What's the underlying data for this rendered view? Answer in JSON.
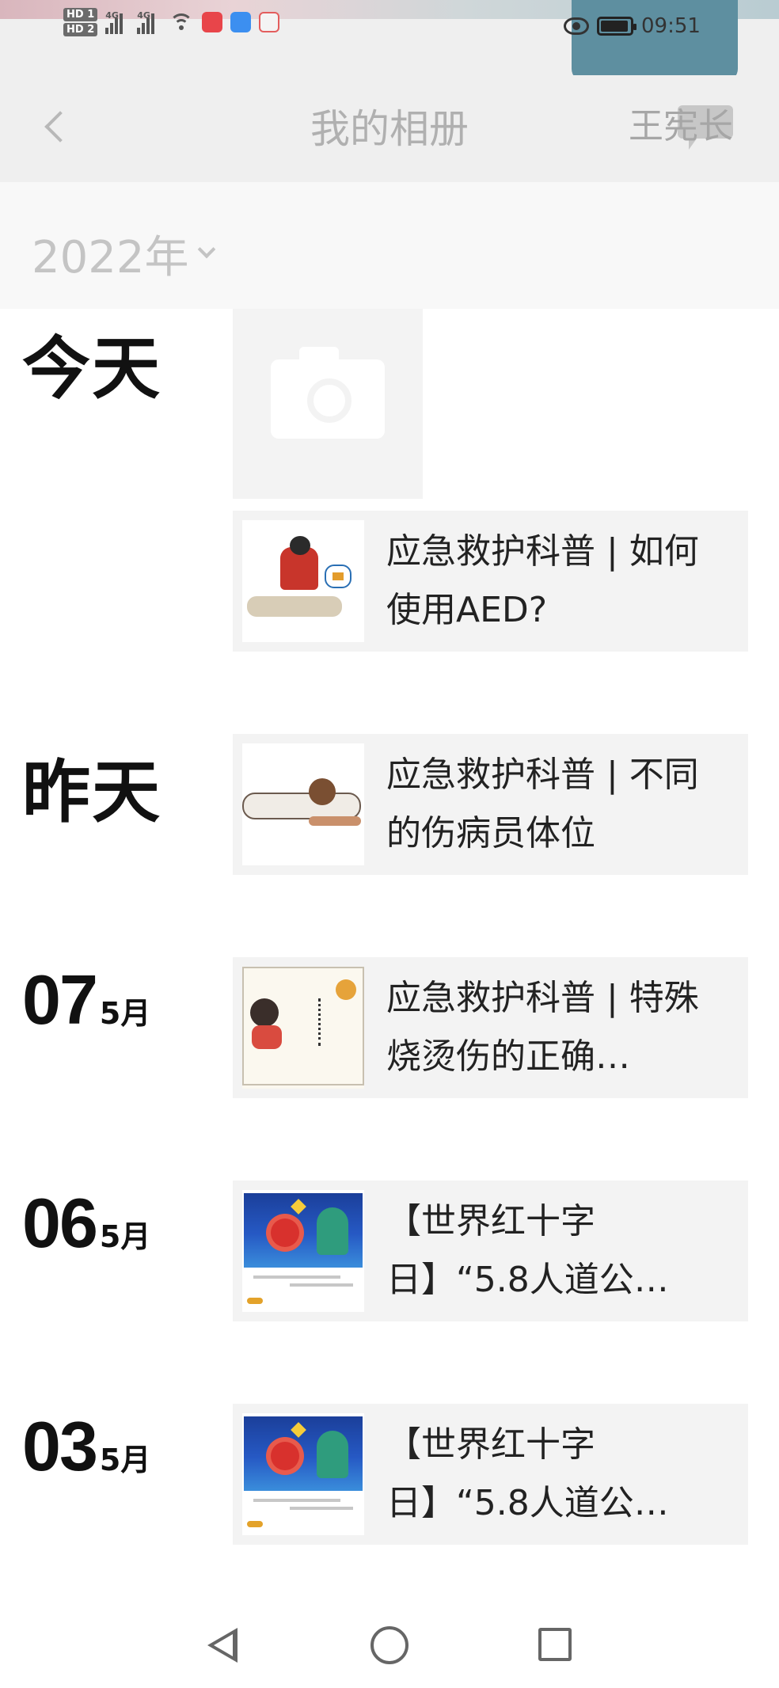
{
  "status_bar": {
    "hd1": "HD 1",
    "hd2": "HD 2",
    "net1": "4G",
    "net2": "4G",
    "time": "09:51",
    "icons": [
      "signal-icon",
      "signal-icon",
      "wifi-icon",
      "app-notification-icon",
      "cloud-icon",
      "message-icon",
      "eye-icon",
      "battery-icon"
    ]
  },
  "header": {
    "back_icon": "back-chevron-icon",
    "title": "我的相册",
    "owner": "王宪长"
  },
  "filter": {
    "year": "2022年",
    "dropdown_icon": "chevron-down-icon"
  },
  "groups": [
    {
      "day": "",
      "month": "",
      "label": "今天"
    },
    {
      "day": "",
      "month": "",
      "label": "昨天"
    },
    {
      "day": "07",
      "month": "5月",
      "label": ""
    },
    {
      "day": "06",
      "month": "5月",
      "label": ""
    },
    {
      "day": "03",
      "month": "5月",
      "label": ""
    }
  ],
  "camera_tile": {
    "icon": "camera-icon"
  },
  "articles": [
    {
      "title": "应急救护科普 | 如何使用AED?"
    },
    {
      "title": "应急救护科普 | 不同的伤病员体位"
    },
    {
      "title": "应急救护科普 | 特殊烧烫伤的正确…"
    },
    {
      "title": "【世界红十字日】“5.8人道公…"
    },
    {
      "title": "【世界红十字日】“5.8人道公…"
    }
  ],
  "system_nav": {
    "back": "nav-back-icon",
    "home": "nav-home-icon",
    "recent": "nav-recent-icon"
  }
}
